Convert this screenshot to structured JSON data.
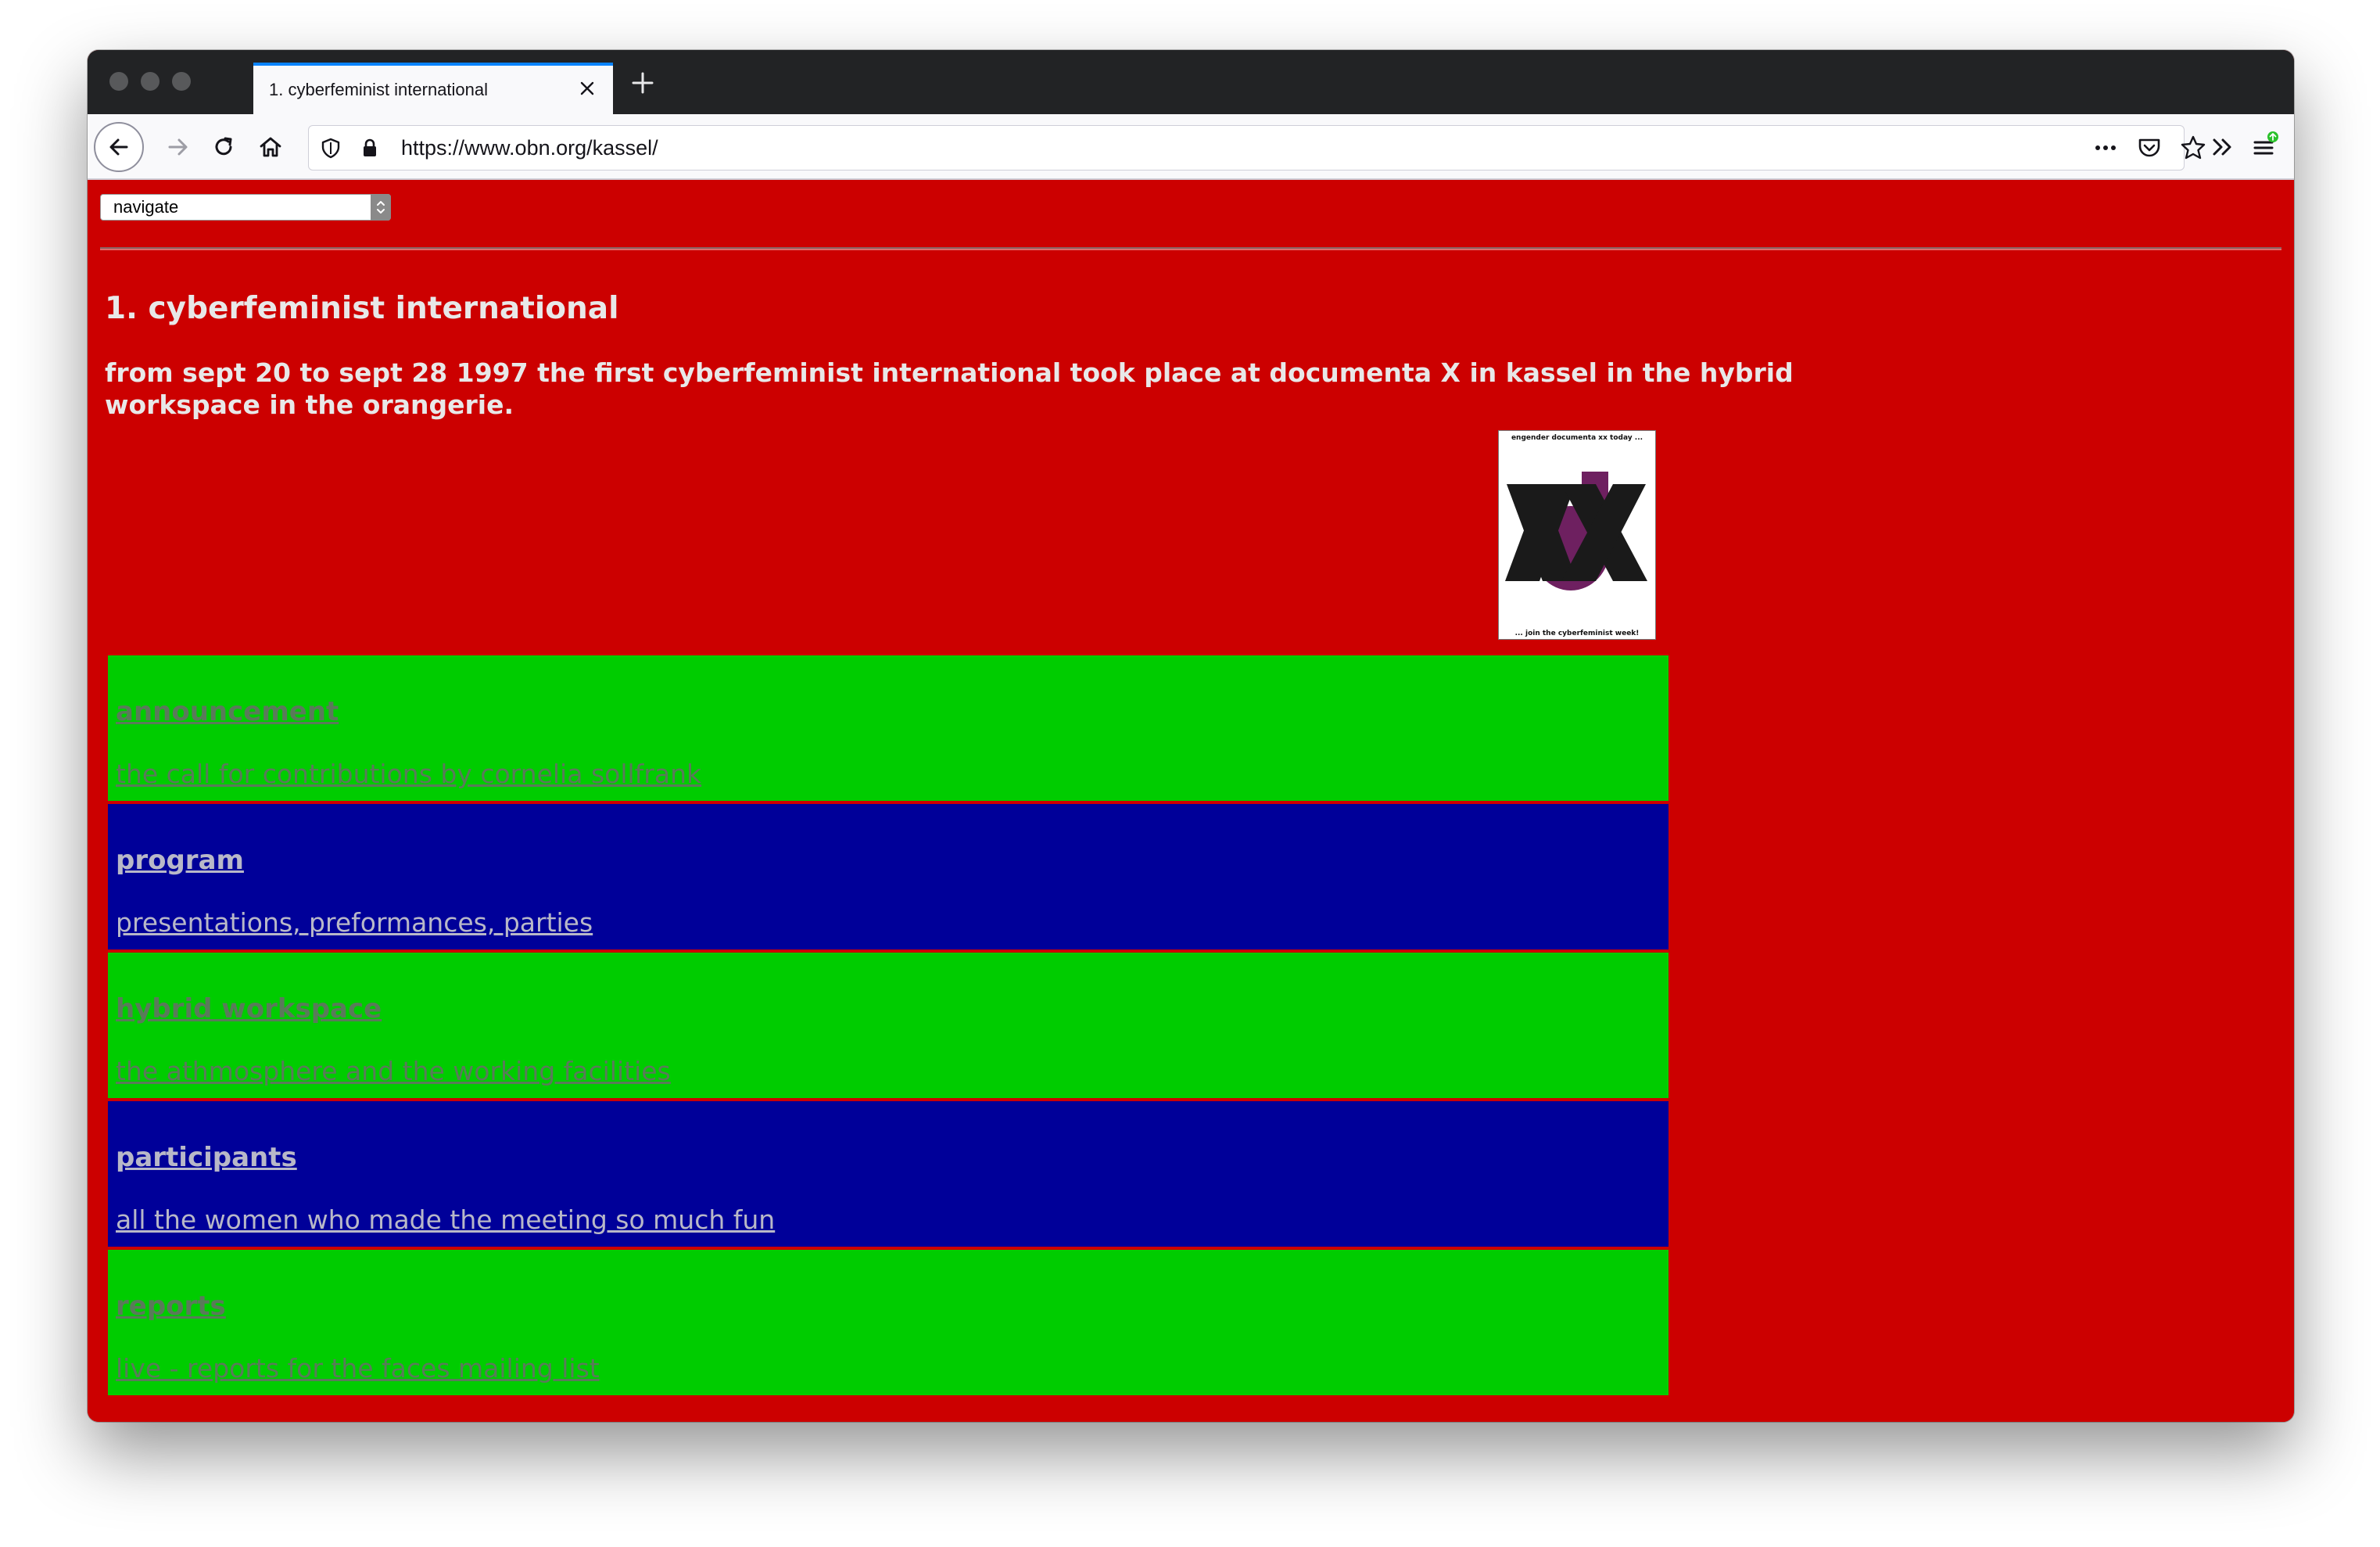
{
  "browser": {
    "tab_title": "1. cyberfeminist international",
    "url": "https://www.obn.org/kassel/"
  },
  "page": {
    "navigate_select": "navigate",
    "heading": "1. cyberfeminist international",
    "intro_line1": "from sept 20 to sept 28 1997 the first cyberfeminist international took place at documenta X in kassel in the hybrid",
    "intro_line2": "workspace in the orangerie.",
    "poster": {
      "top_text": "engender documenta xx today ...",
      "bottom_text": "... join the cyberfeminist week!"
    },
    "sections": [
      {
        "title": "announcement",
        "desc": "the call for contributions by cornelia sollfrank",
        "color": "#00cc00"
      },
      {
        "title": "program",
        "desc": "presentations, preformances, parties",
        "color": "#000099"
      },
      {
        "title": "hybrid workspace",
        "desc": "the athmosphere and the working facilities",
        "color": "#00cc00"
      },
      {
        "title": "participants",
        "desc": "all the women who made the meeting so much fun",
        "color": "#000099"
      },
      {
        "title": "reports",
        "desc": "live - reports for the faces mailing list",
        "color": "#00cc00"
      }
    ]
  },
  "colors": {
    "page_background": "#cc0000",
    "green_row": "#00cc00",
    "blue_row": "#000099",
    "tab_accent": "#0a84ff"
  }
}
